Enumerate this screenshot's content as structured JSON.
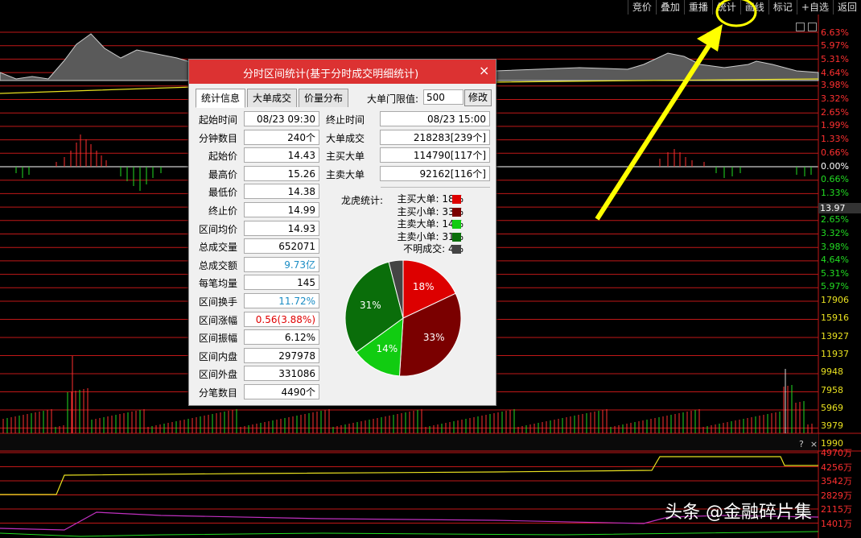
{
  "toolbar": {
    "buttons": [
      "竞价",
      "叠加",
      "重播",
      "统计",
      "画线",
      "标记",
      "+自选",
      "返回"
    ]
  },
  "price_axis": {
    "labels": [
      {
        "text": "6.63%",
        "color": "#ff3030"
      },
      {
        "text": "5.97%",
        "color": "#ff3030"
      },
      {
        "text": "5.31%",
        "color": "#ff3030"
      },
      {
        "text": "4.64%",
        "color": "#ff3030"
      },
      {
        "text": "3.98%",
        "color": "#ff3030"
      },
      {
        "text": "3.32%",
        "color": "#ff3030"
      },
      {
        "text": "2.65%",
        "color": "#ff3030"
      },
      {
        "text": "1.99%",
        "color": "#ff3030"
      },
      {
        "text": "1.33%",
        "color": "#ff3030"
      },
      {
        "text": "0.66%",
        "color": "#ff3030"
      },
      {
        "text": "0.00%",
        "color": "#ffffff"
      },
      {
        "text": "0.66%",
        "color": "#22dd22"
      },
      {
        "text": "1.33%",
        "color": "#22dd22"
      },
      {
        "text": "2.65%",
        "color": "#22dd22"
      },
      {
        "text": "3.32%",
        "color": "#22dd22"
      },
      {
        "text": "3.98%",
        "color": "#22dd22"
      },
      {
        "text": "4.64%",
        "color": "#22dd22"
      },
      {
        "text": "5.31%",
        "color": "#22dd22"
      },
      {
        "text": "5.97%",
        "color": "#22dd22"
      }
    ],
    "current_price": "13.97"
  },
  "volume_axis": {
    "labels": [
      "17906",
      "15916",
      "13927",
      "11937",
      "9948",
      "7958",
      "5969",
      "3979",
      "1990"
    ],
    "color": "#e8e020"
  },
  "sub_axis": {
    "labels": [
      "4970万",
      "4256万",
      "3542万",
      "2829万",
      "2115万",
      "1401万"
    ],
    "color": "#ff3030",
    "icons": [
      "help-icon",
      "close-icon"
    ],
    "help_glyph": "?",
    "close_glyph": "×"
  },
  "dialog": {
    "title": "分时区间统计(基于分时成交明细统计)",
    "close_glyph": "×",
    "tabs": [
      "统计信息",
      "大单成交",
      "价量分布"
    ],
    "threshold_label": "大单门限值:",
    "threshold_value": "500",
    "modify_button": "修改",
    "left_stats": [
      {
        "label": "起始时间",
        "value": "08/23 09:30",
        "color": "#000"
      },
      {
        "label": "分钟数目",
        "value": "240个",
        "color": "#000"
      },
      {
        "label": "起始价",
        "value": "14.43",
        "color": "#000"
      },
      {
        "label": "最高价",
        "value": "15.26",
        "color": "#000"
      },
      {
        "label": "最低价",
        "value": "14.38",
        "color": "#000"
      },
      {
        "label": "终止价",
        "value": "14.99",
        "color": "#000"
      },
      {
        "label": "区间均价",
        "value": "14.93",
        "color": "#000"
      },
      {
        "label": "总成交量",
        "value": "652071",
        "color": "#000"
      },
      {
        "label": "总成交额",
        "value": "9.73亿",
        "color": "#1a8cc4"
      },
      {
        "label": "每笔均量",
        "value": "145",
        "color": "#000"
      },
      {
        "label": "区间换手",
        "value": "11.72%",
        "color": "#1a8cc4"
      },
      {
        "label": "区间涨幅",
        "value": "0.56(3.88%)",
        "color": "#e00000"
      },
      {
        "label": "区间振幅",
        "value": "6.12%",
        "color": "#000"
      },
      {
        "label": "区间内盘",
        "value": "297978",
        "color": "#000"
      },
      {
        "label": "区间外盘",
        "value": "331086",
        "color": "#000"
      },
      {
        "label": "分笔数目",
        "value": "4490个",
        "color": "#000"
      }
    ],
    "right_stats": [
      {
        "label": "终止时间",
        "value": "08/23 15:00"
      },
      {
        "label": "大单成交",
        "value": "218283[239个]"
      },
      {
        "label": "主买大单",
        "value": "114790[117个]"
      },
      {
        "label": "主卖大单",
        "value": "92162[116个]"
      }
    ],
    "legend_title": "龙虎统计:",
    "legend": [
      {
        "name": "主买大单",
        "value": "18%",
        "color": "#dd0000"
      },
      {
        "name": "主买小单",
        "value": "33%",
        "color": "#7a0000"
      },
      {
        "name": "主卖大单",
        "value": "14%",
        "color": "#11cc11"
      },
      {
        "name": "主卖小单",
        "value": "31%",
        "color": "#0a6e0a"
      },
      {
        "name": "不明成交",
        "value": "4%",
        "color": "#444444"
      }
    ]
  },
  "chart_data": {
    "type": "pie",
    "title": "龙虎统计",
    "categories": [
      "主买大单",
      "主买小单",
      "主卖大单",
      "主卖小单",
      "不明成交"
    ],
    "values": [
      18,
      33,
      14,
      31,
      4
    ],
    "colors": [
      "#dd0000",
      "#7a0000",
      "#11cc11",
      "#0a6e0a",
      "#444444"
    ]
  },
  "watermark": "头条 @金融碎片集",
  "annotation_color": "#ffff00"
}
